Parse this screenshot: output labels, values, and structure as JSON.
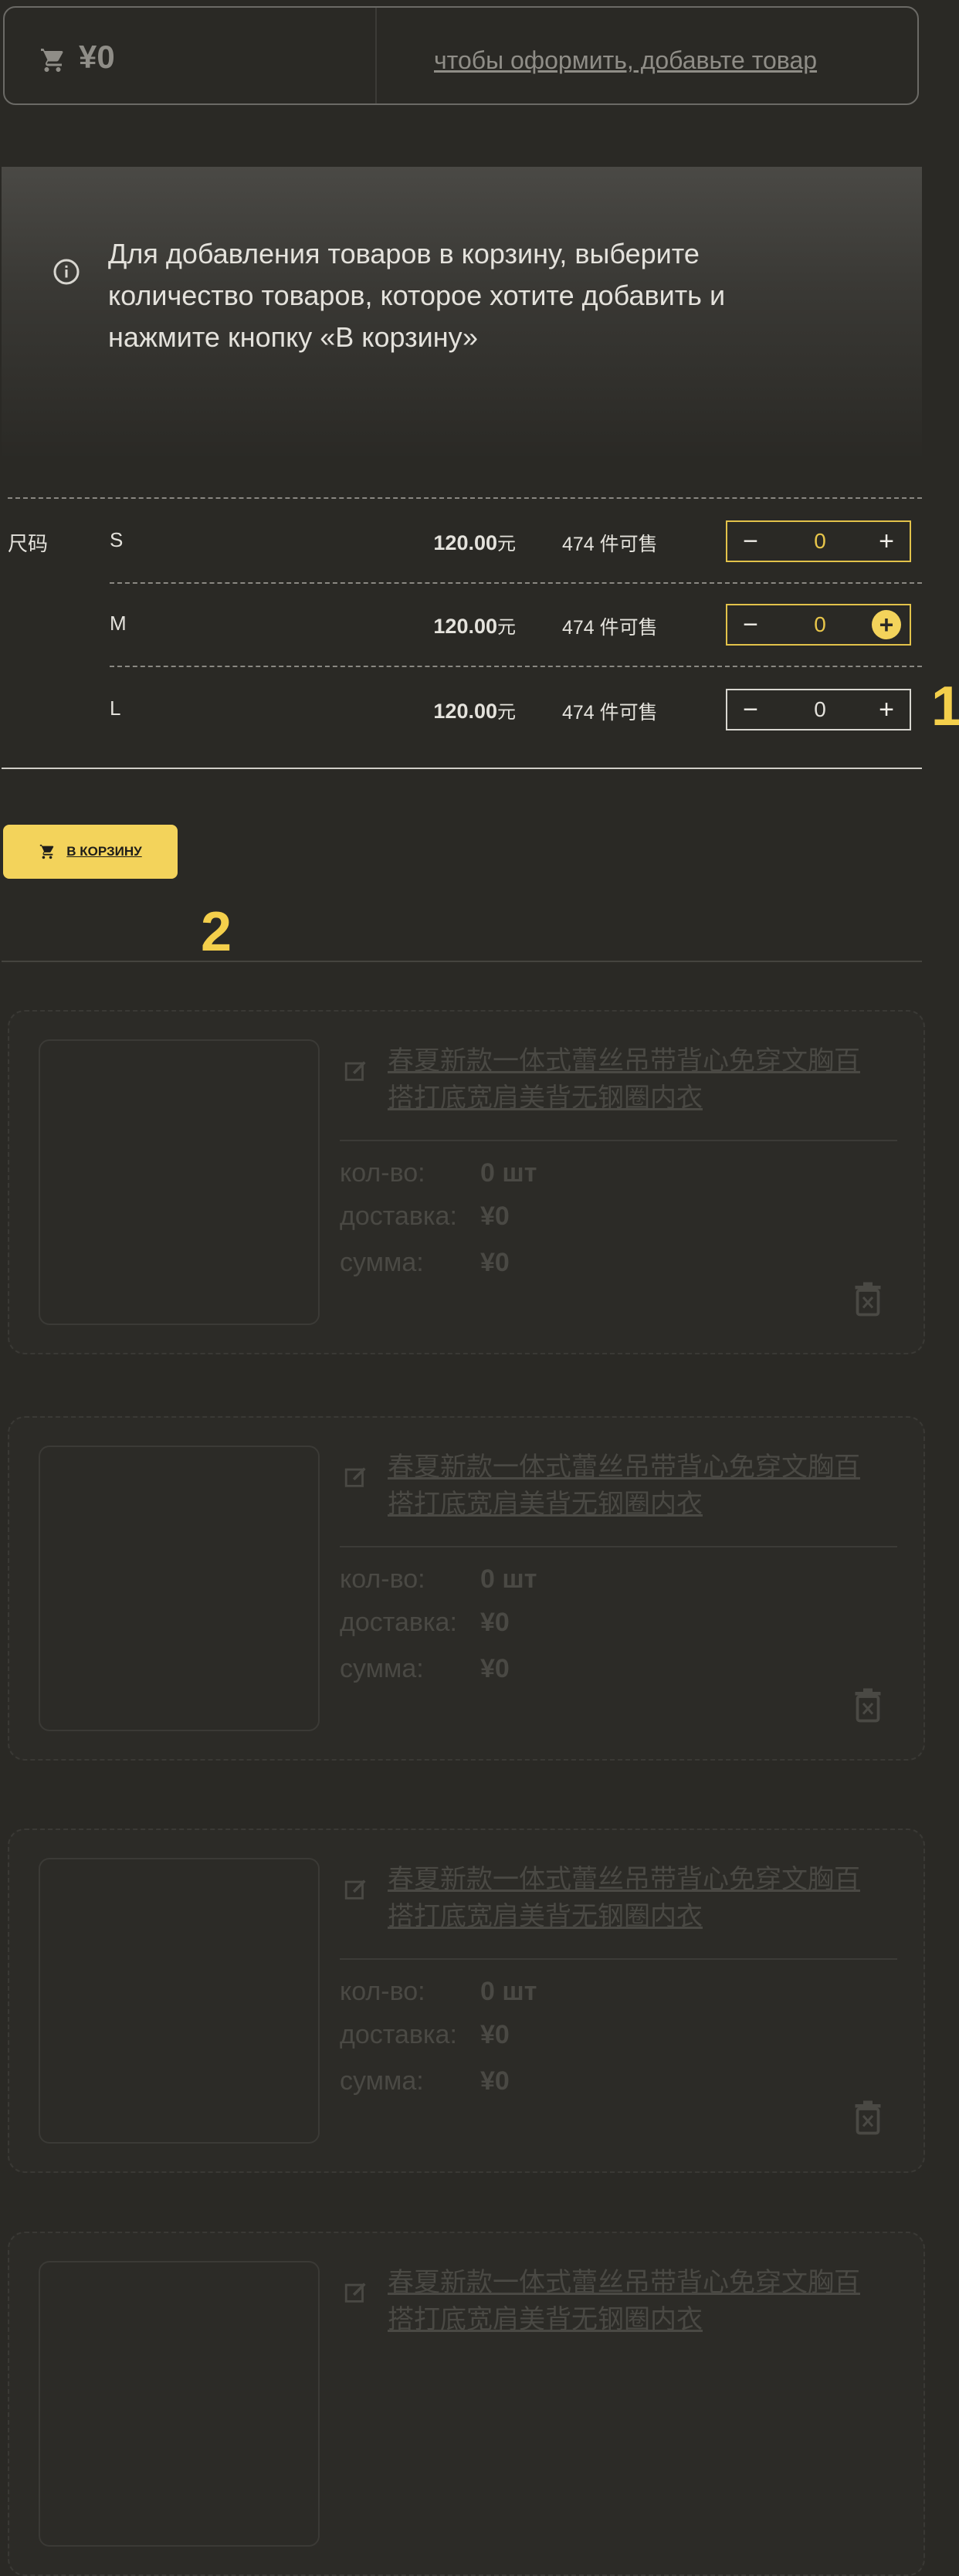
{
  "cart": {
    "total": "¥0",
    "hint": "чтобы оформить, добавьте товар"
  },
  "info": {
    "text": "Для добавления товаров в корзину, выберите количество товаров, которое хотите добавить и нажмите кнопку «В корзину»"
  },
  "sizes": {
    "group_label": "尺码",
    "rows": [
      {
        "name": "S",
        "price": "120.00",
        "currency": "元",
        "stock": "474 件可售",
        "qty": "0"
      },
      {
        "name": "M",
        "price": "120.00",
        "currency": "元",
        "stock": "474 件可售",
        "qty": "0"
      },
      {
        "name": "L",
        "price": "120.00",
        "currency": "元",
        "stock": "474 件可售",
        "qty": "0"
      }
    ]
  },
  "markers": {
    "one": "1",
    "two": "2"
  },
  "add_button": {
    "label": "В КОРЗИНУ"
  },
  "items": [
    {
      "title": "春夏新款一体式蕾丝吊带背心免穿文胸百搭打底宽肩美背无钢圈内衣",
      "qty_label": "кол-во:",
      "qty": "0 шт",
      "delivery_label": "доставка:",
      "delivery": "¥0",
      "sum_label": "сумма:",
      "sum": "¥0"
    },
    {
      "title": "春夏新款一体式蕾丝吊带背心免穿文胸百搭打底宽肩美背无钢圈内衣",
      "qty_label": "кол-во:",
      "qty": "0 шт",
      "delivery_label": "доставка:",
      "delivery": "¥0",
      "sum_label": "сумма:",
      "sum": "¥0"
    },
    {
      "title": "春夏新款一体式蕾丝吊带背心免穿文胸百搭打底宽肩美背无钢圈内衣",
      "qty_label": "кол-во:",
      "qty": "0 шт",
      "delivery_label": "доставка:",
      "delivery": "¥0",
      "sum_label": "сумма:",
      "sum": "¥0"
    },
    {
      "title": "春夏新款一体式蕾丝吊带背心免穿文胸百搭打底宽肩美背无钢圈内衣"
    }
  ],
  "colors": {
    "accent": "#f3d35b",
    "background": "#2a2925"
  }
}
